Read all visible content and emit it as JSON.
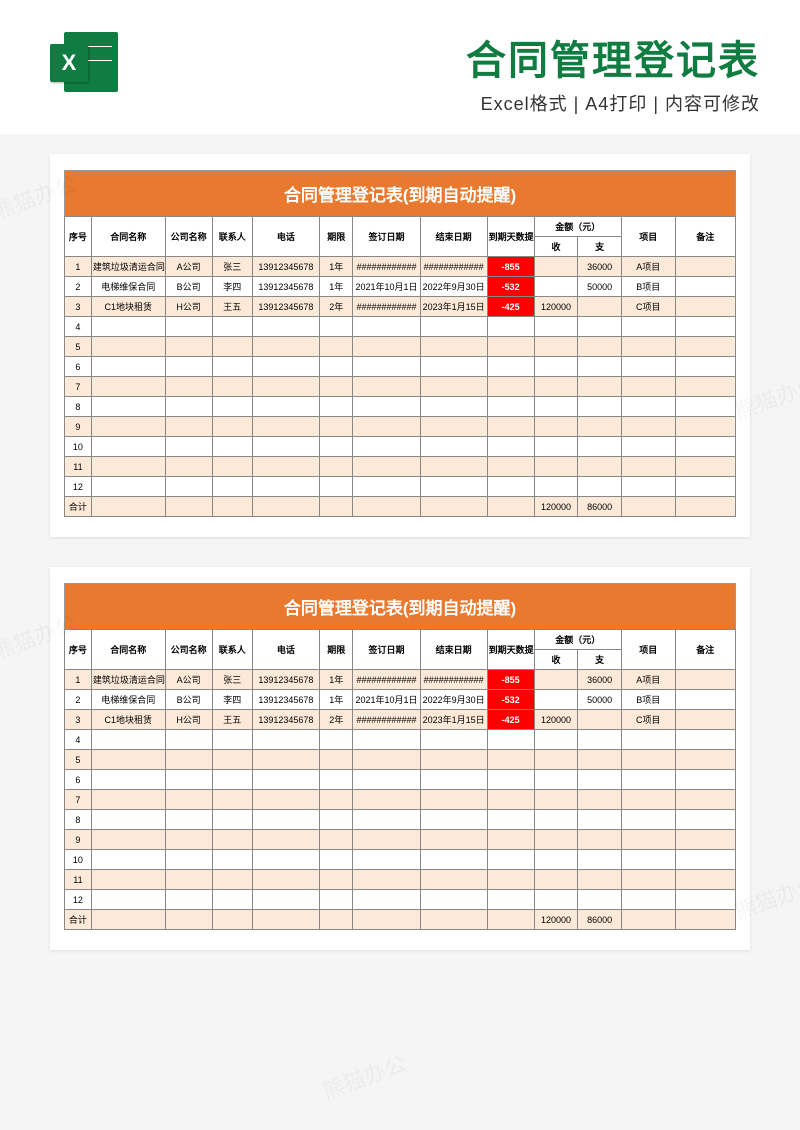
{
  "header": {
    "icon_letter": "X",
    "main_title": "合同管理登记表",
    "subtitle": "Excel格式 | A4打印 | 内容可修改"
  },
  "table": {
    "title": "合同管理登记表(到期自动提醒)",
    "headers": {
      "seq": "序号",
      "name": "合同名称",
      "company": "公司名称",
      "contact": "联系人",
      "phone": "电话",
      "period": "期限",
      "sign_date": "签订日期",
      "end_date": "结束日期",
      "alert": "到期天数提醒",
      "amount": "金额（元）",
      "income": "收",
      "expense": "支",
      "project": "项目",
      "note": "备注"
    },
    "rows": [
      {
        "seq": "1",
        "name": "建筑垃圾清运合同",
        "company": "A公司",
        "contact": "张三",
        "phone": "13912345678",
        "period": "1年",
        "sign": "############",
        "end": "############",
        "alert": "-855",
        "income": "",
        "expense": "36000",
        "project": "A项目",
        "note": ""
      },
      {
        "seq": "2",
        "name": "电梯维保合同",
        "company": "B公司",
        "contact": "李四",
        "phone": "13912345678",
        "period": "1年",
        "sign": "2021年10月1日",
        "end": "2022年9月30日",
        "alert": "-532",
        "income": "",
        "expense": "50000",
        "project": "B项目",
        "note": ""
      },
      {
        "seq": "3",
        "name": "C1地块租赁",
        "company": "H公司",
        "contact": "王五",
        "phone": "13912345678",
        "period": "2年",
        "sign": "############",
        "end": "2023年1月15日",
        "alert": "-425",
        "income": "120000",
        "expense": "",
        "project": "C项目",
        "note": ""
      },
      {
        "seq": "4"
      },
      {
        "seq": "5"
      },
      {
        "seq": "6"
      },
      {
        "seq": "7"
      },
      {
        "seq": "8"
      },
      {
        "seq": "9"
      },
      {
        "seq": "10"
      },
      {
        "seq": "11"
      },
      {
        "seq": "12"
      }
    ],
    "total": {
      "label": "合计",
      "income": "120000",
      "expense": "86000"
    }
  },
  "watermark": "熊猫办公"
}
